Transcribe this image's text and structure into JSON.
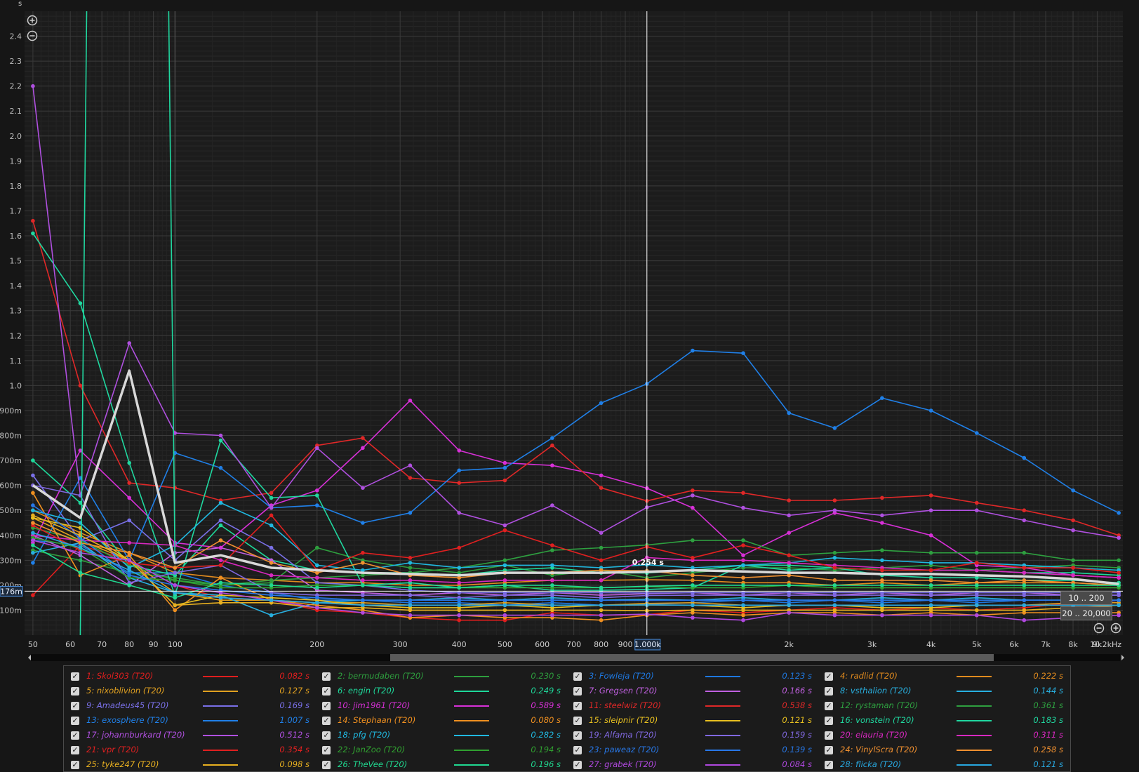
{
  "chart_data": {
    "type": "line",
    "y_unit_label": "s",
    "x_unit_label": "kHz",
    "x_scale": "log",
    "xlim": [
      48,
      10200
    ],
    "ylim": [
      0.0,
      2.5
    ],
    "grid": true,
    "y_ticks": [
      {
        "v": 0.1,
        "label": "100m"
      },
      {
        "v": 0.2,
        "label": "200m"
      },
      {
        "v": 0.3,
        "label": "300m"
      },
      {
        "v": 0.4,
        "label": "400m"
      },
      {
        "v": 0.5,
        "label": "500m"
      },
      {
        "v": 0.6,
        "label": "600m"
      },
      {
        "v": 0.7,
        "label": "700m"
      },
      {
        "v": 0.8,
        "label": "800m"
      },
      {
        "v": 0.9,
        "label": "900m"
      },
      {
        "v": 1.0,
        "label": "1.0"
      },
      {
        "v": 1.1,
        "label": "1.1"
      },
      {
        "v": 1.2,
        "label": "1.2"
      },
      {
        "v": 1.3,
        "label": "1.3"
      },
      {
        "v": 1.4,
        "label": "1.4"
      },
      {
        "v": 1.5,
        "label": "1.5"
      },
      {
        "v": 1.6,
        "label": "1.6"
      },
      {
        "v": 1.7,
        "label": "1.7"
      },
      {
        "v": 1.8,
        "label": "1.8"
      },
      {
        "v": 1.9,
        "label": "1.9"
      },
      {
        "v": 2.0,
        "label": "2.0"
      },
      {
        "v": 2.1,
        "label": "2.1"
      },
      {
        "v": 2.2,
        "label": "2.2"
      },
      {
        "v": 2.3,
        "label": "2.3"
      },
      {
        "v": 2.4,
        "label": "2.4"
      }
    ],
    "x_ticks": [
      {
        "v": 50,
        "label": "50"
      },
      {
        "v": 60,
        "label": "60"
      },
      {
        "v": 70,
        "label": "70"
      },
      {
        "v": 80,
        "label": "80"
      },
      {
        "v": 90,
        "label": "90"
      },
      {
        "v": 100,
        "label": "100"
      },
      {
        "v": 200,
        "label": "200"
      },
      {
        "v": 300,
        "label": "300"
      },
      {
        "v": 400,
        "label": "400"
      },
      {
        "v": 500,
        "label": "500"
      },
      {
        "v": 600,
        "label": "600"
      },
      {
        "v": 700,
        "label": "700"
      },
      {
        "v": 800,
        "label": "800"
      },
      {
        "v": 900,
        "label": "900"
      },
      {
        "v": 2000,
        "label": "2k"
      },
      {
        "v": 3000,
        "label": "3k"
      },
      {
        "v": 4000,
        "label": "4k"
      },
      {
        "v": 5000,
        "label": "5k"
      },
      {
        "v": 6000,
        "label": "6k"
      },
      {
        "v": 7000,
        "label": "7k"
      },
      {
        "v": 8000,
        "label": "8k"
      },
      {
        "v": 9000,
        "label": "9k"
      },
      {
        "v": 10200,
        "label": "10.2kHz"
      }
    ],
    "x": [
      50,
      63,
      80,
      100,
      125,
      160,
      200,
      250,
      315,
      400,
      500,
      630,
      800,
      1000,
      1250,
      1600,
      2000,
      2500,
      3150,
      4000,
      5000,
      6300,
      8000,
      10000
    ],
    "cursor": {
      "x": 1000,
      "x_label": "1.000k",
      "y": 0.176,
      "y_label": "176m",
      "value_label": "0.254 s"
    },
    "range_buttons": [
      "10 .. 200",
      "20 .. 20,000"
    ],
    "average": {
      "color": "#d8d8d8",
      "values": [
        0.6,
        0.47,
        1.06,
        0.29,
        0.32,
        0.27,
        0.26,
        0.25,
        0.245,
        0.24,
        0.25,
        0.25,
        0.25,
        0.254,
        0.26,
        0.255,
        0.25,
        0.25,
        0.245,
        0.245,
        0.24,
        0.235,
        0.225,
        0.205
      ]
    },
    "series": [
      {
        "id": 1,
        "name": "1: Skol303 (T20)",
        "color": "#e01e1e",
        "value": "0.082 s",
        "values": [
          0.16,
          0.36,
          0.3,
          0.2,
          0.15,
          0.14,
          0.1,
          0.09,
          0.07,
          0.06,
          0.06,
          0.09,
          0.08,
          0.082,
          0.1,
          0.09,
          0.1,
          0.11,
          0.1,
          0.11,
          0.1,
          0.11,
          0.13,
          0.14
        ]
      },
      {
        "id": 2,
        "name": "2: bermudaben (T20)",
        "color": "#2e9e3e",
        "value": "0.230 s",
        "values": [
          0.34,
          0.3,
          0.25,
          0.23,
          0.2,
          0.21,
          0.35,
          0.3,
          0.27,
          0.25,
          0.28,
          0.24,
          0.26,
          0.23,
          0.25,
          0.27,
          0.27,
          0.26,
          0.27,
          0.28,
          0.26,
          0.27,
          0.28,
          0.27
        ]
      },
      {
        "id": 3,
        "name": "3: Fowleja (T20)",
        "color": "#1e78e0",
        "value": "0.123 s",
        "values": [
          0.38,
          0.36,
          0.25,
          0.25,
          0.2,
          0.17,
          0.14,
          0.14,
          0.13,
          0.13,
          0.12,
          0.13,
          0.12,
          0.123,
          0.13,
          0.14,
          0.13,
          0.14,
          0.13,
          0.14,
          0.13,
          0.14,
          0.14,
          0.13
        ]
      },
      {
        "id": 4,
        "name": "4: radlid (T20)",
        "color": "#e08a1e",
        "value": "0.222 s",
        "values": [
          0.5,
          0.41,
          0.33,
          0.25,
          0.23,
          0.22,
          0.21,
          0.21,
          0.2,
          0.2,
          0.21,
          0.22,
          0.22,
          0.222,
          0.22,
          0.21,
          0.21,
          0.2,
          0.21,
          0.2,
          0.21,
          0.21,
          0.21,
          0.2
        ]
      },
      {
        "id": 5,
        "name": "5: nixoblivion (T20)",
        "color": "#e0a020",
        "value": "0.127 s",
        "values": [
          0.47,
          0.38,
          0.3,
          0.17,
          0.14,
          0.14,
          0.13,
          0.13,
          0.12,
          0.12,
          0.13,
          0.12,
          0.12,
          0.127,
          0.13,
          0.12,
          0.12,
          0.12,
          0.12,
          0.12,
          0.12,
          0.12,
          0.13,
          0.13
        ]
      },
      {
        "id": 6,
        "name": "6: engin (T20)",
        "color": "#1ed89a",
        "value": "0.249 s",
        "values": [
          0.7,
          0.53,
          0.28,
          0.24,
          0.44,
          0.3,
          0.26,
          0.25,
          0.25,
          0.24,
          0.26,
          0.27,
          0.25,
          0.249,
          0.26,
          0.28,
          0.28,
          0.27,
          0.26,
          0.26,
          0.26,
          0.25,
          0.25,
          0.24
        ]
      },
      {
        "id": 7,
        "name": "7: Gregsen (T20)",
        "color": "#c060e0",
        "value": "0.166 s",
        "values": [
          0.4,
          0.32,
          0.2,
          0.33,
          0.35,
          0.3,
          0.18,
          0.17,
          0.16,
          0.17,
          0.16,
          0.17,
          0.16,
          0.166,
          0.17,
          0.16,
          0.17,
          0.16,
          0.17,
          0.16,
          0.17,
          0.17,
          0.16,
          0.16
        ]
      },
      {
        "id": 8,
        "name": "8: vsthalion (T20)",
        "color": "#28b0e0",
        "value": "0.144 s",
        "values": [
          0.33,
          0.37,
          0.23,
          0.17,
          0.16,
          0.08,
          0.13,
          0.14,
          0.14,
          0.15,
          0.14,
          0.15,
          0.14,
          0.144,
          0.14,
          0.15,
          0.14,
          0.14,
          0.15,
          0.14,
          0.15,
          0.14,
          0.14,
          0.14
        ]
      },
      {
        "id": 9,
        "name": "9: Amadeus45 (T20)",
        "color": "#7a70e8",
        "value": "0.169 s",
        "values": [
          0.64,
          0.38,
          0.46,
          0.3,
          0.46,
          0.35,
          0.21,
          0.2,
          0.18,
          0.17,
          0.17,
          0.17,
          0.17,
          0.169,
          0.17,
          0.17,
          0.17,
          0.17,
          0.17,
          0.17,
          0.17,
          0.17,
          0.17,
          0.17
        ]
      },
      {
        "id": 10,
        "name": "10: jim1961 (T20)",
        "color": "#d830d8",
        "value": "0.589 s",
        "values": [
          0.37,
          0.74,
          0.55,
          0.37,
          0.35,
          0.52,
          0.58,
          0.75,
          0.94,
          0.74,
          0.69,
          0.68,
          0.64,
          0.589,
          0.51,
          0.32,
          0.41,
          0.49,
          0.45,
          0.4,
          0.28,
          0.27,
          0.24,
          0.23
        ]
      },
      {
        "id": 11,
        "name": "11: steelwiz (T20)",
        "color": "#e02828",
        "value": "0.538 s",
        "values": [
          1.66,
          1.0,
          0.61,
          0.59,
          0.54,
          0.57,
          0.76,
          0.79,
          0.63,
          0.61,
          0.62,
          0.76,
          0.59,
          0.538,
          0.58,
          0.57,
          0.54,
          0.54,
          0.55,
          0.56,
          0.53,
          0.5,
          0.46,
          0.4
        ]
      },
      {
        "id": 12,
        "name": "12: rystaman (T20)",
        "color": "#2ea040",
        "value": "0.361 s",
        "values": [
          0.43,
          0.38,
          0.28,
          0.22,
          0.2,
          0.22,
          0.23,
          0.24,
          0.25,
          0.27,
          0.3,
          0.34,
          0.35,
          0.361,
          0.38,
          0.38,
          0.32,
          0.33,
          0.34,
          0.33,
          0.33,
          0.33,
          0.3,
          0.3
        ]
      },
      {
        "id": 13,
        "name": "13: exosphere (T20)",
        "color": "#2080e8",
        "value": "1.007  s",
        "values": [
          0.29,
          0.63,
          0.3,
          0.73,
          0.67,
          0.51,
          0.52,
          0.45,
          0.49,
          0.66,
          0.67,
          0.79,
          0.93,
          1.007,
          1.14,
          1.13,
          0.89,
          0.83,
          0.95,
          0.9,
          0.81,
          0.71,
          0.58,
          0.49
        ]
      },
      {
        "id": 14,
        "name": "14: Stephaan (T20)",
        "color": "#f09020",
        "value": "0.080 s",
        "values": [
          0.57,
          0.24,
          0.32,
          0.1,
          0.23,
          0.14,
          0.12,
          0.1,
          0.07,
          0.08,
          0.07,
          0.07,
          0.06,
          0.08,
          0.09,
          0.08,
          0.09,
          0.09,
          0.08,
          0.09,
          0.08,
          0.09,
          0.09,
          0.09
        ]
      },
      {
        "id": 15,
        "name": "15: sleipnir (T20)",
        "color": "#e8c020",
        "value": "0.121 s",
        "values": [
          0.47,
          0.43,
          0.3,
          0.12,
          0.16,
          0.15,
          0.14,
          0.12,
          0.11,
          0.11,
          0.12,
          0.11,
          0.12,
          0.121,
          0.12,
          0.11,
          0.12,
          0.12,
          0.11,
          0.11,
          0.12,
          0.12,
          0.12,
          0.12
        ]
      },
      {
        "id": 16,
        "name": "16: vonstein (T20)",
        "color": "#20d8a0",
        "value": "0.183 s",
        "values": [
          1.61,
          1.33,
          0.69,
          0.16,
          0.78,
          0.55,
          0.56,
          0.2,
          0.21,
          0.19,
          0.2,
          0.18,
          0.18,
          0.183,
          0.19,
          0.28,
          0.26,
          0.27,
          0.24,
          0.23,
          0.23,
          0.22,
          0.22,
          0.21
        ]
      },
      {
        "id": 17,
        "name": "17: johannburkard (T20)",
        "color": "#b050e0",
        "value": "0.512 s",
        "values": [
          2.2,
          0.56,
          1.17,
          0.81,
          0.8,
          0.51,
          0.75,
          0.59,
          0.68,
          0.49,
          0.44,
          0.52,
          0.41,
          0.512,
          0.56,
          0.51,
          0.48,
          0.5,
          0.48,
          0.5,
          0.5,
          0.46,
          0.42,
          0.39
        ]
      },
      {
        "id": 18,
        "name": "18: pfg (T20)",
        "color": "#20b8e0",
        "value": "0.282 s",
        "values": [
          0.5,
          0.45,
          0.27,
          0.36,
          0.53,
          0.44,
          0.28,
          0.26,
          0.29,
          0.27,
          0.28,
          0.28,
          0.27,
          0.282,
          0.27,
          0.28,
          0.29,
          0.31,
          0.3,
          0.29,
          0.29,
          0.28,
          0.27,
          0.26
        ]
      },
      {
        "id": 19,
        "name": "19: Alfama (T20)",
        "color": "#8068e0",
        "value": "0.159 s",
        "values": [
          0.6,
          0.56,
          0.21,
          0.25,
          0.28,
          0.17,
          0.16,
          0.16,
          0.16,
          0.15,
          0.16,
          0.16,
          0.15,
          0.159,
          0.16,
          0.16,
          0.16,
          0.16,
          0.16,
          0.16,
          0.16,
          0.16,
          0.16,
          0.16
        ]
      },
      {
        "id": 20,
        "name": "20: elauria (T20)",
        "color": "#d828c0",
        "value": "0.311 s",
        "values": [
          0.4,
          0.38,
          0.37,
          0.36,
          0.3,
          0.24,
          0.23,
          0.22,
          0.22,
          0.21,
          0.22,
          0.22,
          0.22,
          0.311,
          0.3,
          0.3,
          0.29,
          0.28,
          0.27,
          0.26,
          0.26,
          0.25,
          0.24,
          0.23
        ]
      },
      {
        "id": 21,
        "name": "21: vpr (T20)",
        "color": "#e02020",
        "value": "0.354 s",
        "values": [
          0.44,
          0.34,
          0.29,
          0.27,
          0.28,
          0.48,
          0.26,
          0.33,
          0.31,
          0.35,
          0.42,
          0.36,
          0.3,
          0.354,
          0.31,
          0.36,
          0.32,
          0.27,
          0.26,
          0.26,
          0.29,
          0.27,
          0.27,
          0.25
        ]
      },
      {
        "id": 22,
        "name": "22: JanZoo (T20)",
        "color": "#30a030",
        "value": "0.194 s",
        "values": [
          0.39,
          0.35,
          0.23,
          0.22,
          0.19,
          0.19,
          0.2,
          0.2,
          0.19,
          0.19,
          0.19,
          0.19,
          0.19,
          0.194,
          0.19,
          0.19,
          0.2,
          0.19,
          0.19,
          0.19,
          0.19,
          0.19,
          0.19,
          0.19
        ]
      },
      {
        "id": 23,
        "name": "23: paweaz (T20)",
        "color": "#2878e8",
        "value": "0.139 s",
        "values": [
          0.52,
          0.39,
          0.24,
          0.2,
          0.18,
          0.16,
          0.15,
          0.14,
          0.14,
          0.14,
          0.14,
          0.14,
          0.14,
          0.139,
          0.14,
          0.14,
          0.14,
          0.14,
          0.14,
          0.14,
          0.14,
          0.14,
          0.14,
          0.14
        ]
      },
      {
        "id": 24,
        "name": "24: VinylScra (T20)",
        "color": "#f09030",
        "value": "0.258 s",
        "values": [
          0.45,
          0.37,
          0.33,
          0.27,
          0.38,
          0.29,
          0.25,
          0.29,
          0.24,
          0.23,
          0.25,
          0.25,
          0.26,
          0.258,
          0.24,
          0.23,
          0.24,
          0.22,
          0.22,
          0.22,
          0.21,
          0.22,
          0.21,
          0.2
        ]
      },
      {
        "id": 25,
        "name": "25: tyke247 (T20)",
        "color": "#e8b020",
        "value": "0.098 s",
        "values": [
          0.48,
          0.4,
          0.3,
          0.12,
          0.13,
          0.13,
          0.11,
          0.11,
          0.1,
          0.1,
          0.1,
          0.1,
          0.1,
          0.098,
          0.1,
          0.1,
          0.1,
          0.1,
          0.1,
          0.1,
          0.1,
          0.1,
          0.11,
          0.12
        ]
      },
      {
        "id": 26,
        "name": "26: TheVee (T20)",
        "color": "#20d890",
        "value": "0.196 s",
        "values": [
          0.36,
          0.25,
          0.2,
          0.15,
          0.21,
          0.2,
          0.19,
          0.2,
          0.19,
          0.19,
          0.2,
          0.2,
          0.19,
          0.196,
          0.2,
          0.2,
          0.2,
          0.2,
          0.2,
          0.2,
          0.2,
          0.2,
          0.2,
          0.2
        ]
      },
      {
        "id": 27,
        "name": "27: grabek (T20)",
        "color": "#b048e0",
        "value": "0.084 s",
        "values": [
          0.38,
          0.33,
          0.3,
          0.2,
          0.17,
          0.14,
          0.11,
          0.09,
          0.08,
          0.08,
          0.08,
          0.08,
          0.08,
          0.084,
          0.07,
          0.06,
          0.09,
          0.08,
          0.08,
          0.08,
          0.08,
          0.06,
          0.07,
          0.08
        ]
      },
      {
        "id": 28,
        "name": "28: flicka (T20)",
        "color": "#28a8e0",
        "value": "0.121 s",
        "values": [
          0.41,
          0.35,
          0.26,
          0.17,
          0.15,
          0.14,
          0.13,
          0.12,
          0.12,
          0.12,
          0.12,
          0.12,
          0.12,
          0.121,
          0.12,
          0.12,
          0.12,
          0.12,
          0.12,
          0.12,
          0.12,
          0.12,
          0.12,
          0.12
        ]
      }
    ],
    "spikes": [
      {
        "color": "#20d8a0",
        "points": [
          [
            63,
            0.0
          ],
          [
            65,
            2.5
          ]
        ]
      },
      {
        "color": "#20d8a0",
        "points": [
          [
            97,
            2.5
          ],
          [
            100,
            0.3
          ]
        ]
      }
    ]
  }
}
